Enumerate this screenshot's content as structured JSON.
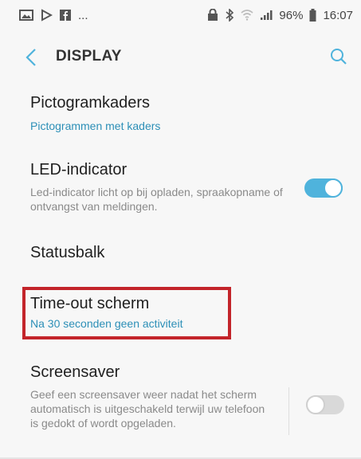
{
  "status_bar": {
    "left_icons": [
      "gallery-icon",
      "play-store-icon",
      "facebook-icon"
    ],
    "overflow": "...",
    "battery": "96%",
    "time": "16:07"
  },
  "header": {
    "title": "DISPLAY"
  },
  "items": [
    {
      "title": "Pictogramkaders",
      "subtitle": "Pictogrammen met kaders"
    },
    {
      "title": "LED-indicator",
      "description": "Led-indicator licht op bij opladen, spraakopname of ontvangst van meldingen.",
      "toggle_on": true
    },
    {
      "title": "Statusbalk"
    },
    {
      "title": "Time-out scherm",
      "subtitle": "Na 30 seconden geen activiteit"
    },
    {
      "title": "Screensaver",
      "description": "Geef een screensaver weer nadat het scherm automatisch is uitgeschakeld terwijl uw telefoon is gedokt of wordt opgeladen.",
      "toggle_on": false
    }
  ],
  "colors": {
    "accent": "#4fb3dc",
    "subtitle": "#2c8fb7",
    "highlight": "#c3242a"
  }
}
